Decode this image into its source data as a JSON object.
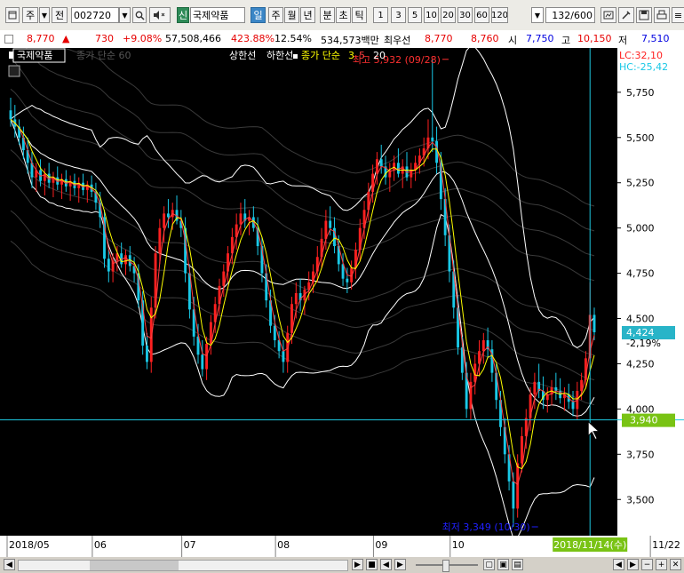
{
  "toolbar": {
    "period_label": "주",
    "prev_label": "전",
    "stock_code": "002720",
    "badge": "신",
    "stock_name": "국제약품",
    "tabs": [
      "일",
      "주",
      "월",
      "년",
      "분",
      "초",
      "틱"
    ],
    "numbers": [
      "1",
      "3",
      "5",
      "10",
      "20",
      "30",
      "60",
      "120"
    ],
    "page_count": "132",
    "page_total": "/600"
  },
  "info": {
    "price": "8,770",
    "arrow": "▲",
    "change": "730",
    "change_pct": "+9.08%",
    "volume": "57,508,466",
    "volume_pct": "423.88%",
    "turnover": "12.54%",
    "amount": "534,573백만",
    "pref_label": "최우선",
    "pref1": "8,770",
    "pref2": "8,760",
    "open_label": "시",
    "open": "7,750",
    "high_label": "고",
    "high": "10,150",
    "low_label": "저",
    "low": "7,510"
  },
  "chart_data": {
    "type": "candlestick",
    "title": "국제약품",
    "legend": [
      "종가 단순 60",
      "상한선",
      "하한선",
      "종가 단순",
      "3",
      "5",
      "20"
    ],
    "ylim": [
      3300,
      5980
    ],
    "y_ticks": [
      3500,
      3750,
      4000,
      4250,
      4500,
      4750,
      5000,
      5250,
      5500,
      5750
    ],
    "y_tick_labels": [
      "3,500",
      "3,750",
      "4,000",
      "4,250",
      "4,500",
      "4,750",
      "5,000",
      "5,250",
      "5,500",
      "5,750"
    ],
    "x_labels": [
      {
        "label": "2018/05",
        "index": 0
      },
      {
        "label": "06",
        "index": 20
      },
      {
        "label": "07",
        "index": 41
      },
      {
        "label": "08",
        "index": 63
      },
      {
        "label": "09",
        "index": 86
      },
      {
        "label": "10",
        "index": 104
      },
      {
        "label": "11/22",
        "index": 151
      }
    ],
    "crosshair": {
      "date": "2018/11/14(수)",
      "index": 136,
      "price": 3940,
      "price_label": "3,940"
    },
    "current": {
      "price": 4424,
      "label": "4,424",
      "change_pct": "-2,19%"
    },
    "annotations": {
      "high": {
        "text": "최고 5,932 (09/28)",
        "index": 103,
        "price": 5932
      },
      "low": {
        "text": "최저 3,349 (10/30)",
        "index": 124,
        "price": 3349
      }
    },
    "lc": "LC:32,10",
    "hc": "HC:-25,42",
    "candles": [
      {
        "o": 5650,
        "h": 5720,
        "l": 5560,
        "c": 5600
      },
      {
        "o": 5600,
        "h": 5680,
        "l": 5500,
        "c": 5560
      },
      {
        "o": 5560,
        "h": 5600,
        "l": 5460,
        "c": 5500
      },
      {
        "o": 5500,
        "h": 5560,
        "l": 5380,
        "c": 5430
      },
      {
        "o": 5430,
        "h": 5500,
        "l": 5300,
        "c": 5360
      },
      {
        "o": 5360,
        "h": 5420,
        "l": 5220,
        "c": 5280
      },
      {
        "o": 5280,
        "h": 5360,
        "l": 5200,
        "c": 5320
      },
      {
        "o": 5320,
        "h": 5380,
        "l": 5230,
        "c": 5260
      },
      {
        "o": 5260,
        "h": 5330,
        "l": 5180,
        "c": 5300
      },
      {
        "o": 5300,
        "h": 5360,
        "l": 5220,
        "c": 5250
      },
      {
        "o": 5250,
        "h": 5310,
        "l": 5170,
        "c": 5280
      },
      {
        "o": 5280,
        "h": 5340,
        "l": 5210,
        "c": 5240
      },
      {
        "o": 5240,
        "h": 5300,
        "l": 5160,
        "c": 5270
      },
      {
        "o": 5270,
        "h": 5320,
        "l": 5200,
        "c": 5230
      },
      {
        "o": 5230,
        "h": 5290,
        "l": 5150,
        "c": 5260
      },
      {
        "o": 5260,
        "h": 5300,
        "l": 5180,
        "c": 5220
      },
      {
        "o": 5220,
        "h": 5280,
        "l": 5140,
        "c": 5250
      },
      {
        "o": 5250,
        "h": 5300,
        "l": 5180,
        "c": 5210
      },
      {
        "o": 5210,
        "h": 5260,
        "l": 5140,
        "c": 5240
      },
      {
        "o": 5240,
        "h": 5290,
        "l": 5170,
        "c": 5200
      },
      {
        "o": 5200,
        "h": 5250,
        "l": 5100,
        "c": 5140
      },
      {
        "o": 5140,
        "h": 5200,
        "l": 5000,
        "c": 5060
      },
      {
        "o": 5060,
        "h": 5100,
        "l": 4780,
        "c": 4830
      },
      {
        "o": 4830,
        "h": 4880,
        "l": 4700,
        "c": 4760
      },
      {
        "o": 4760,
        "h": 4860,
        "l": 4700,
        "c": 4820
      },
      {
        "o": 4820,
        "h": 4900,
        "l": 4760,
        "c": 4860
      },
      {
        "o": 4860,
        "h": 4920,
        "l": 4780,
        "c": 4800
      },
      {
        "o": 4800,
        "h": 4880,
        "l": 4740,
        "c": 4850
      },
      {
        "o": 4850,
        "h": 4900,
        "l": 4760,
        "c": 4790
      },
      {
        "o": 4790,
        "h": 4840,
        "l": 4700,
        "c": 4750
      },
      {
        "o": 4750,
        "h": 4800,
        "l": 4560,
        "c": 4600
      },
      {
        "o": 4600,
        "h": 4650,
        "l": 4300,
        "c": 4350
      },
      {
        "o": 4350,
        "h": 4420,
        "l": 4220,
        "c": 4260
      },
      {
        "o": 4260,
        "h": 4620,
        "l": 4200,
        "c": 4560
      },
      {
        "o": 4560,
        "h": 4900,
        "l": 4500,
        "c": 4860
      },
      {
        "o": 4860,
        "h": 5050,
        "l": 4800,
        "c": 5000
      },
      {
        "o": 5000,
        "h": 5120,
        "l": 4920,
        "c": 5080
      },
      {
        "o": 5080,
        "h": 5160,
        "l": 5000,
        "c": 5060
      },
      {
        "o": 5060,
        "h": 5140,
        "l": 4990,
        "c": 5100
      },
      {
        "o": 5100,
        "h": 5180,
        "l": 5020,
        "c": 5040
      },
      {
        "o": 5040,
        "h": 5100,
        "l": 4950,
        "c": 5000
      },
      {
        "o": 5000,
        "h": 5060,
        "l": 4700,
        "c": 4750
      },
      {
        "o": 4750,
        "h": 4800,
        "l": 4500,
        "c": 4550
      },
      {
        "o": 4550,
        "h": 4620,
        "l": 4350,
        "c": 4400
      },
      {
        "o": 4400,
        "h": 4470,
        "l": 4250,
        "c": 4300
      },
      {
        "o": 4300,
        "h": 4380,
        "l": 4180,
        "c": 4220
      },
      {
        "o": 4220,
        "h": 4400,
        "l": 4160,
        "c": 4360
      },
      {
        "o": 4360,
        "h": 4520,
        "l": 4300,
        "c": 4480
      },
      {
        "o": 4480,
        "h": 4620,
        "l": 4420,
        "c": 4580
      },
      {
        "o": 4580,
        "h": 4720,
        "l": 4520,
        "c": 4680
      },
      {
        "o": 4680,
        "h": 4800,
        "l": 4620,
        "c": 4760
      },
      {
        "o": 4760,
        "h": 4900,
        "l": 4700,
        "c": 4860
      },
      {
        "o": 4860,
        "h": 5000,
        "l": 4800,
        "c": 4950
      },
      {
        "o": 4950,
        "h": 5080,
        "l": 4880,
        "c": 5020
      },
      {
        "o": 5020,
        "h": 5140,
        "l": 4960,
        "c": 5080
      },
      {
        "o": 5080,
        "h": 5160,
        "l": 5000,
        "c": 5040
      },
      {
        "o": 5040,
        "h": 5100,
        "l": 4960,
        "c": 5060
      },
      {
        "o": 5060,
        "h": 5120,
        "l": 4980,
        "c": 5000
      },
      {
        "o": 5000,
        "h": 5060,
        "l": 4850,
        "c": 4900
      },
      {
        "o": 4900,
        "h": 4950,
        "l": 4700,
        "c": 4750
      },
      {
        "o": 4750,
        "h": 4800,
        "l": 4560,
        "c": 4600
      },
      {
        "o": 4600,
        "h": 4660,
        "l": 4420,
        "c": 4460
      },
      {
        "o": 4460,
        "h": 4520,
        "l": 4340,
        "c": 4380
      },
      {
        "o": 4380,
        "h": 4430,
        "l": 4280,
        "c": 4320
      },
      {
        "o": 4320,
        "h": 4380,
        "l": 4200,
        "c": 4260
      },
      {
        "o": 4260,
        "h": 4460,
        "l": 4200,
        "c": 4420
      },
      {
        "o": 4420,
        "h": 4620,
        "l": 4360,
        "c": 4580
      },
      {
        "o": 4580,
        "h": 4700,
        "l": 4500,
        "c": 4640
      },
      {
        "o": 4640,
        "h": 4720,
        "l": 4540,
        "c": 4600
      },
      {
        "o": 4600,
        "h": 4680,
        "l": 4520,
        "c": 4660
      },
      {
        "o": 4660,
        "h": 4760,
        "l": 4600,
        "c": 4700
      },
      {
        "o": 4700,
        "h": 4800,
        "l": 4640,
        "c": 4760
      },
      {
        "o": 4760,
        "h": 4900,
        "l": 4700,
        "c": 4840
      },
      {
        "o": 4840,
        "h": 5000,
        "l": 4780,
        "c": 4940
      },
      {
        "o": 4940,
        "h": 5100,
        "l": 4880,
        "c": 5040
      },
      {
        "o": 5040,
        "h": 5120,
        "l": 4960,
        "c": 5000
      },
      {
        "o": 5000,
        "h": 5060,
        "l": 4860,
        "c": 4900
      },
      {
        "o": 4900,
        "h": 4960,
        "l": 4760,
        "c": 4800
      },
      {
        "o": 4800,
        "h": 4860,
        "l": 4680,
        "c": 4720
      },
      {
        "o": 4720,
        "h": 4780,
        "l": 4640,
        "c": 4700
      },
      {
        "o": 4700,
        "h": 4820,
        "l": 4660,
        "c": 4780
      },
      {
        "o": 4780,
        "h": 4920,
        "l": 4720,
        "c": 4880
      },
      {
        "o": 4880,
        "h": 5050,
        "l": 4820,
        "c": 5000
      },
      {
        "o": 5000,
        "h": 5150,
        "l": 4940,
        "c": 5100
      },
      {
        "o": 5100,
        "h": 5250,
        "l": 5040,
        "c": 5200
      },
      {
        "o": 5200,
        "h": 5350,
        "l": 5140,
        "c": 5300
      },
      {
        "o": 5300,
        "h": 5420,
        "l": 5240,
        "c": 5380
      },
      {
        "o": 5380,
        "h": 5460,
        "l": 5300,
        "c": 5340
      },
      {
        "o": 5340,
        "h": 5400,
        "l": 5240,
        "c": 5280
      },
      {
        "o": 5280,
        "h": 5360,
        "l": 5200,
        "c": 5320
      },
      {
        "o": 5320,
        "h": 5400,
        "l": 5260,
        "c": 5360
      },
      {
        "o": 5360,
        "h": 5440,
        "l": 5280,
        "c": 5300
      },
      {
        "o": 5300,
        "h": 5380,
        "l": 5220,
        "c": 5340
      },
      {
        "o": 5340,
        "h": 5420,
        "l": 5260,
        "c": 5280
      },
      {
        "o": 5280,
        "h": 5360,
        "l": 5220,
        "c": 5320
      },
      {
        "o": 5320,
        "h": 5400,
        "l": 5260,
        "c": 5360
      },
      {
        "o": 5360,
        "h": 5440,
        "l": 5300,
        "c": 5400
      },
      {
        "o": 5400,
        "h": 5500,
        "l": 5340,
        "c": 5440
      },
      {
        "o": 5440,
        "h": 5600,
        "l": 5380,
        "c": 5500
      },
      {
        "o": 5500,
        "h": 5932,
        "l": 5420,
        "c": 5480
      },
      {
        "o": 5480,
        "h": 5560,
        "l": 5300,
        "c": 5360
      },
      {
        "o": 5360,
        "h": 5420,
        "l": 5100,
        "c": 5160
      },
      {
        "o": 5160,
        "h": 5220,
        "l": 4900,
        "c": 4960
      },
      {
        "o": 4960,
        "h": 5020,
        "l": 4700,
        "c": 4760
      },
      {
        "o": 4760,
        "h": 4820,
        "l": 4500,
        "c": 4560
      },
      {
        "o": 4560,
        "h": 4620,
        "l": 4300,
        "c": 4340
      },
      {
        "o": 4340,
        "h": 4400,
        "l": 4160,
        "c": 4200
      },
      {
        "o": 4200,
        "h": 4260,
        "l": 3950,
        "c": 4000
      },
      {
        "o": 4000,
        "h": 4200,
        "l": 3940,
        "c": 4150
      },
      {
        "o": 4150,
        "h": 4300,
        "l": 4080,
        "c": 4250
      },
      {
        "o": 4250,
        "h": 4380,
        "l": 4180,
        "c": 4320
      },
      {
        "o": 4320,
        "h": 4420,
        "l": 4250,
        "c": 4380
      },
      {
        "o": 4380,
        "h": 4450,
        "l": 4280,
        "c": 4330
      },
      {
        "o": 4330,
        "h": 4380,
        "l": 4150,
        "c": 4200
      },
      {
        "o": 4200,
        "h": 4250,
        "l": 4000,
        "c": 4050
      },
      {
        "o": 4050,
        "h": 4100,
        "l": 3850,
        "c": 3900
      },
      {
        "o": 3900,
        "h": 3950,
        "l": 3700,
        "c": 3750
      },
      {
        "o": 3750,
        "h": 3800,
        "l": 3550,
        "c": 3600
      },
      {
        "o": 3600,
        "h": 3650,
        "l": 3349,
        "c": 3450
      },
      {
        "o": 3450,
        "h": 3750,
        "l": 3400,
        "c": 3700
      },
      {
        "o": 3700,
        "h": 3900,
        "l": 3650,
        "c": 3850
      },
      {
        "o": 3850,
        "h": 4000,
        "l": 3780,
        "c": 3950
      },
      {
        "o": 3950,
        "h": 4120,
        "l": 3880,
        "c": 4080
      },
      {
        "o": 4080,
        "h": 4200,
        "l": 4000,
        "c": 4150
      },
      {
        "o": 4150,
        "h": 4250,
        "l": 4060,
        "c": 4100
      },
      {
        "o": 4100,
        "h": 4180,
        "l": 4000,
        "c": 4050
      },
      {
        "o": 4050,
        "h": 4120,
        "l": 3980,
        "c": 4080
      },
      {
        "o": 4080,
        "h": 4160,
        "l": 4020,
        "c": 4120
      },
      {
        "o": 4120,
        "h": 4200,
        "l": 4050,
        "c": 4100
      },
      {
        "o": 4100,
        "h": 4170,
        "l": 4030,
        "c": 4060
      },
      {
        "o": 4060,
        "h": 4120,
        "l": 3990,
        "c": 4080
      },
      {
        "o": 4080,
        "h": 4140,
        "l": 4000,
        "c": 4040
      },
      {
        "o": 4040,
        "h": 4100,
        "l": 3960,
        "c": 4000
      },
      {
        "o": 4000,
        "h": 4150,
        "l": 3940,
        "c": 4100
      },
      {
        "o": 4100,
        "h": 4200,
        "l": 4050,
        "c": 4160
      },
      {
        "o": 4160,
        "h": 4320,
        "l": 4120,
        "c": 4280
      },
      {
        "o": 4280,
        "h": 4700,
        "l": 4220,
        "c": 4520
      },
      {
        "o": 4520,
        "h": 4560,
        "l": 4380,
        "c": 4424
      }
    ]
  }
}
